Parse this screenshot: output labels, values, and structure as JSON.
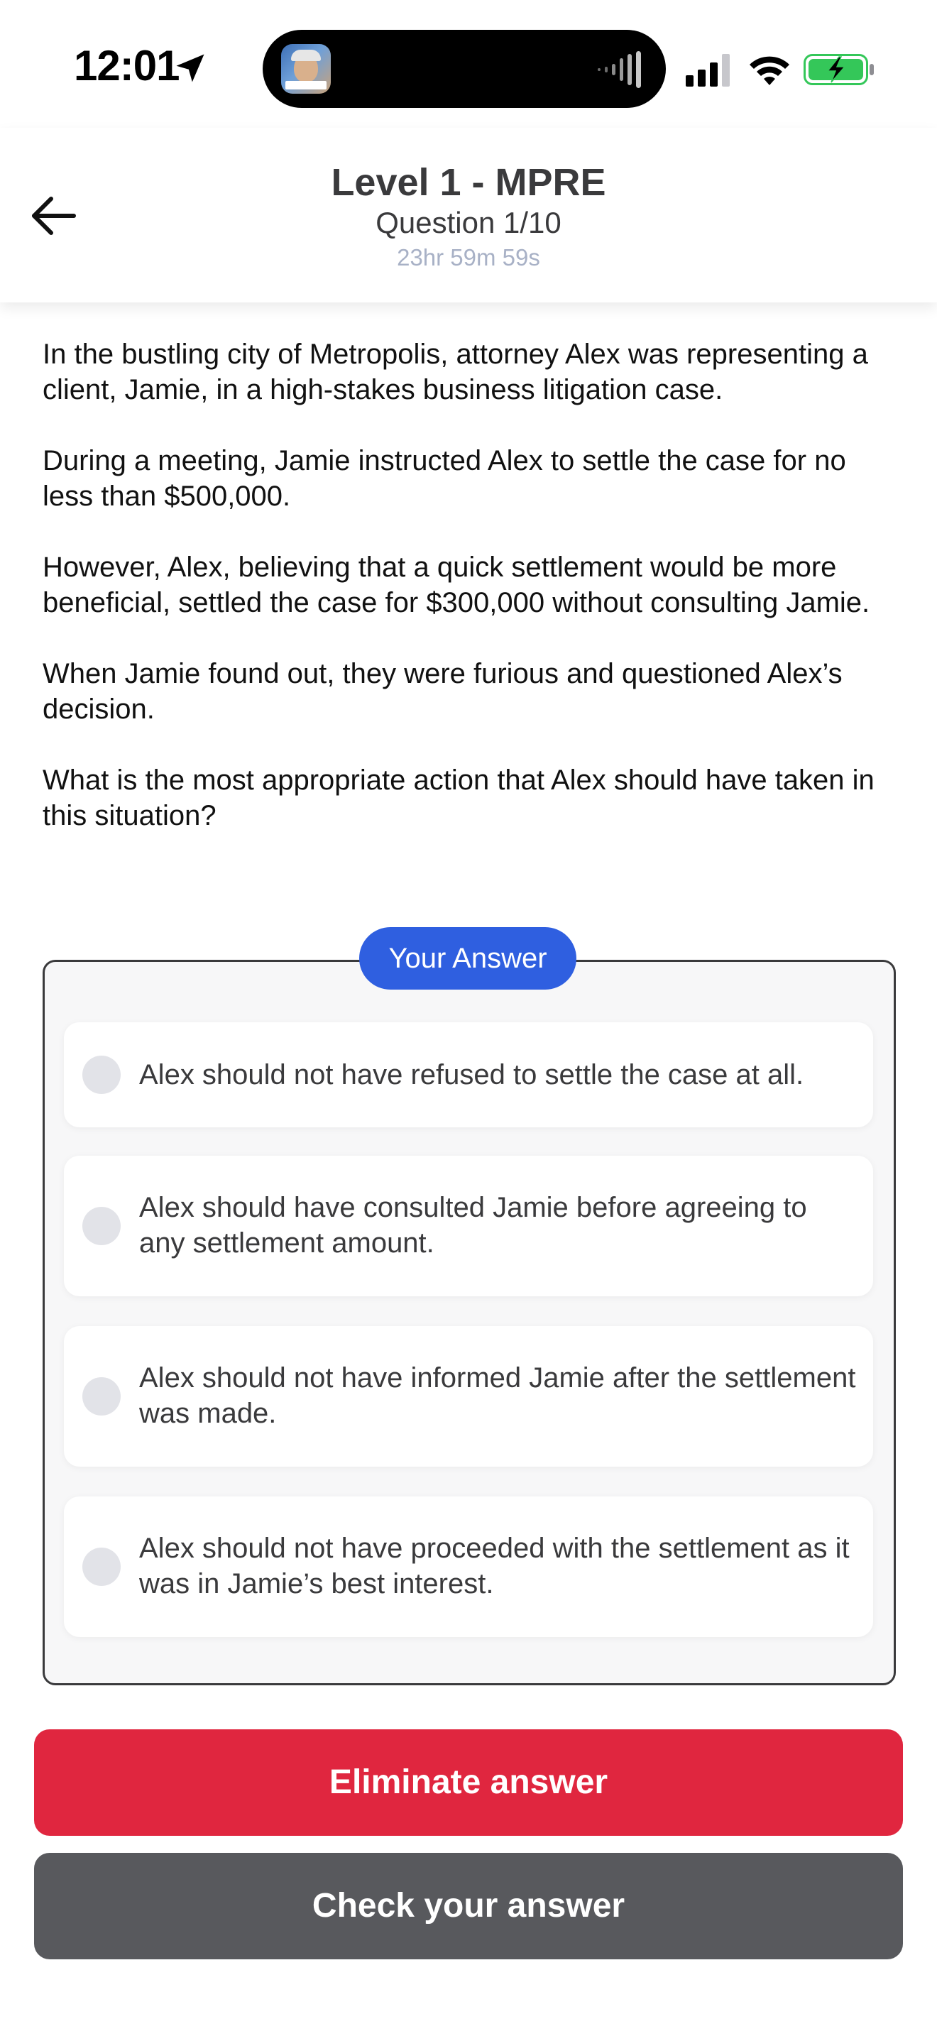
{
  "status_bar": {
    "time": "12:01",
    "battery_color": "#34c759"
  },
  "header": {
    "title": "Level 1 - MPRE",
    "subtitle": "Question 1/10",
    "timer": "23hr 59m 59s"
  },
  "question": {
    "paragraphs": [
      "In the bustling city of Metropolis, attorney Alex was representing a client, Jamie, in a high-stakes business litigation case.",
      "During a meeting, Jamie instructed Alex to settle the case for no less than $500,000.",
      "However, Alex, believing that a quick settlement would be more beneficial, settled the case for $300,000 without consulting Jamie.",
      "When Jamie found out, they were furious and questioned Alex’s decision.",
      "What is the most appropriate action that Alex should have taken in this situation?"
    ]
  },
  "answers": {
    "label": "Your Answer",
    "options": [
      "Alex should not have refused to settle the case at all.",
      "Alex should have consulted Jamie before agreeing to any settlement amount.",
      "Alex should not have informed Jamie after the settlement was made.",
      "Alex should not have proceeded with the settlement as it was in Jamie’s best interest."
    ]
  },
  "buttons": {
    "eliminate": "Eliminate answer",
    "check": "Check your answer"
  },
  "colors": {
    "accent_blue": "#2f5fe0",
    "eliminate_red": "#e0263f",
    "check_gray": "#58595d",
    "timer_gray": "#a8b1c6"
  }
}
